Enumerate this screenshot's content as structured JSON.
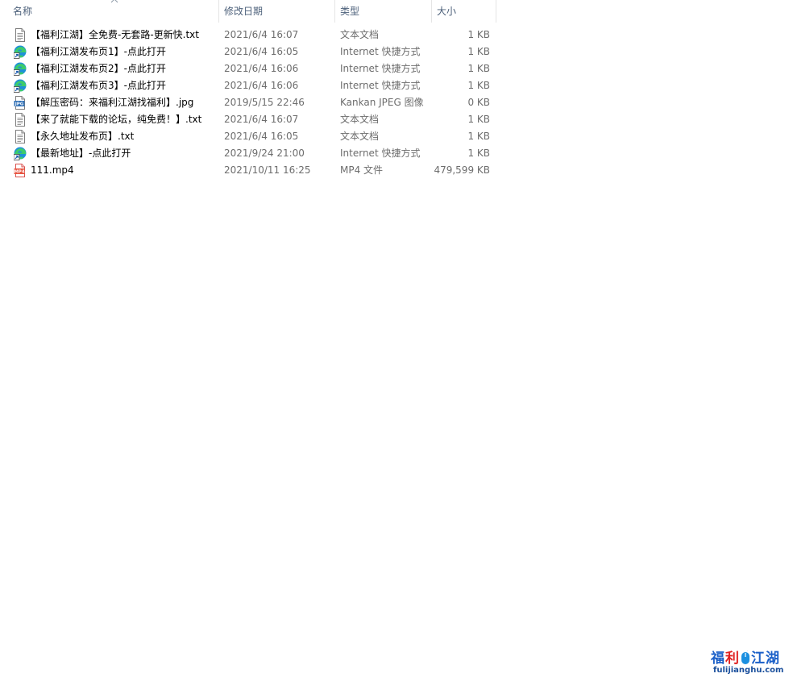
{
  "columns": {
    "name": "名称",
    "date": "修改日期",
    "type": "类型",
    "size": "大小"
  },
  "files": [
    {
      "name": "【福利江湖】全免费-无套路-更新快.txt",
      "date": "2021/6/4 16:07",
      "type": "文本文档",
      "size": "1 KB",
      "icon": "text-file-icon"
    },
    {
      "name": "【福利江湖发布页1】-点此打开",
      "date": "2021/6/4 16:05",
      "type": "Internet 快捷方式",
      "size": "1 KB",
      "icon": "edge-shortcut-icon"
    },
    {
      "name": "【福利江湖发布页2】-点此打开",
      "date": "2021/6/4 16:06",
      "type": "Internet 快捷方式",
      "size": "1 KB",
      "icon": "edge-shortcut-icon"
    },
    {
      "name": "【福利江湖发布页3】-点此打开",
      "date": "2021/6/4 16:06",
      "type": "Internet 快捷方式",
      "size": "1 KB",
      "icon": "edge-shortcut-icon"
    },
    {
      "name": "【解压密码：来福利江湖找福利】.jpg",
      "date": "2019/5/15 22:46",
      "type": "Kankan JPEG 图像",
      "size": "0 KB",
      "icon": "jpeg-image-icon"
    },
    {
      "name": "【来了就能下载的论坛，纯免费！】.txt",
      "date": "2021/6/4 16:07",
      "type": "文本文档",
      "size": "1 KB",
      "icon": "text-file-icon"
    },
    {
      "name": "【永久地址发布页】.txt",
      "date": "2021/6/4 16:05",
      "type": "文本文档",
      "size": "1 KB",
      "icon": "text-file-icon"
    },
    {
      "name": "【最新地址】-点此打开",
      "date": "2021/9/24 21:00",
      "type": "Internet 快捷方式",
      "size": "1 KB",
      "icon": "edge-shortcut-icon"
    },
    {
      "name": "111.mp4",
      "date": "2021/10/11 16:25",
      "type": "MP4 文件",
      "size": "479,599 KB",
      "icon": "mp4-video-icon"
    }
  ],
  "watermark": {
    "chars": [
      "福",
      "利",
      "江",
      "湖"
    ],
    "url": "fulijianghu.com"
  },
  "colors": {
    "header_text": "#4c607a",
    "secondary_text": "#6d6d6d",
    "hover_row": "#e5f3ff"
  }
}
